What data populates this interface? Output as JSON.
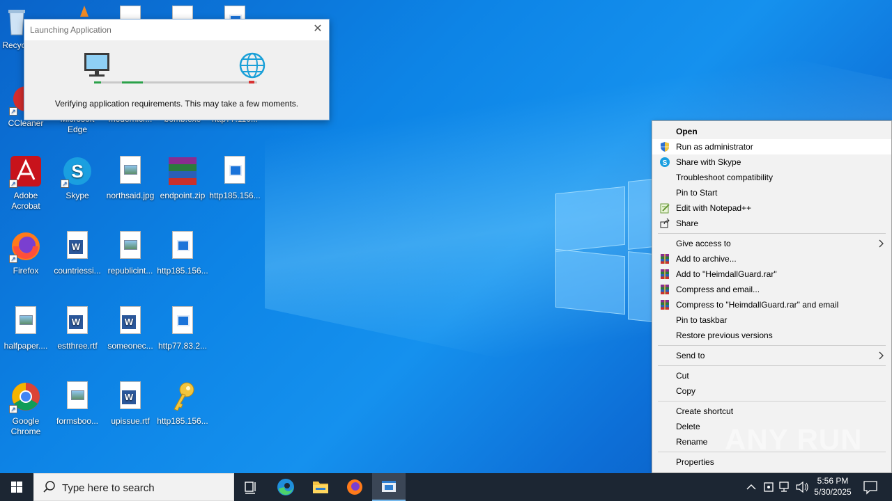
{
  "desktop": {
    "top_row_labels": [
      "Recyc",
      "CCleaner",
      "Microsoft Edge",
      "modernicr...",
      "bomb.exe",
      "http77.110..."
    ],
    "icons": [
      {
        "label": "Adobe Acrobat",
        "type": "acrobat"
      },
      {
        "label": "Skype",
        "type": "skype"
      },
      {
        "label": "northsaid.jpg",
        "type": "image"
      },
      {
        "label": "endpoint.zip",
        "type": "zip"
      },
      {
        "label": "http185.156...",
        "type": "html"
      },
      {
        "label": "Firefox",
        "type": "firefox"
      },
      {
        "label": "countriessi...",
        "type": "word"
      },
      {
        "label": "republicint...",
        "type": "image"
      },
      {
        "label": "http185.156...",
        "type": "html"
      },
      {
        "label": "halfpaper....",
        "type": "image"
      },
      {
        "label": "estthree.rtf",
        "type": "word"
      },
      {
        "label": "someonec...",
        "type": "word"
      },
      {
        "label": "http77.83.2...",
        "type": "html"
      },
      {
        "label": "Google Chrome",
        "type": "chrome"
      },
      {
        "label": "formsboo...",
        "type": "image"
      },
      {
        "label": "upissue.rtf",
        "type": "word"
      },
      {
        "label": "http185.156...",
        "type": "key"
      }
    ]
  },
  "dialog": {
    "title": "Launching Application",
    "close_label": "✕",
    "message": "Verifying application requirements. This may take a few moments."
  },
  "context_menu": {
    "items": [
      {
        "label": "Open",
        "bold": true,
        "icon": ""
      },
      {
        "label": "Run as administrator",
        "icon": "uac-shield-icon",
        "hover": true
      },
      {
        "label": "Share with Skype",
        "icon": "skype-icon"
      },
      {
        "label": "Troubleshoot compatibility",
        "icon": ""
      },
      {
        "label": "Pin to Start",
        "icon": ""
      },
      {
        "label": "Edit with Notepad++",
        "icon": "notepadpp-icon"
      },
      {
        "label": "Share",
        "icon": "share-icon"
      },
      {
        "separator": true
      },
      {
        "label": "Give access to",
        "icon": "",
        "submenu": true
      },
      {
        "label": "Add to archive...",
        "icon": "winrar-icon"
      },
      {
        "label": "Add to \"HeimdallGuard.rar\"",
        "icon": "winrar-icon"
      },
      {
        "label": "Compress and email...",
        "icon": "winrar-icon"
      },
      {
        "label": "Compress to \"HeimdallGuard.rar\" and email",
        "icon": "winrar-icon"
      },
      {
        "label": "Pin to taskbar",
        "icon": ""
      },
      {
        "label": "Restore previous versions",
        "icon": ""
      },
      {
        "separator": true
      },
      {
        "label": "Send to",
        "icon": "",
        "submenu": true
      },
      {
        "separator": true
      },
      {
        "label": "Cut",
        "icon": ""
      },
      {
        "label": "Copy",
        "icon": ""
      },
      {
        "separator": true
      },
      {
        "label": "Create shortcut",
        "icon": ""
      },
      {
        "label": "Delete",
        "icon": ""
      },
      {
        "label": "Rename",
        "icon": ""
      },
      {
        "separator": true
      },
      {
        "label": "Properties",
        "icon": ""
      }
    ]
  },
  "watermark": "ANY RUN",
  "taskbar": {
    "search_placeholder": "Type here to search",
    "time": "5:56 PM",
    "date": "5/30/2025"
  },
  "colors": {
    "desktop_blue": "#0d84e6",
    "taskbar": "#1c2633",
    "progress_green": "#2ba14a",
    "progress_red": "#d83232"
  }
}
